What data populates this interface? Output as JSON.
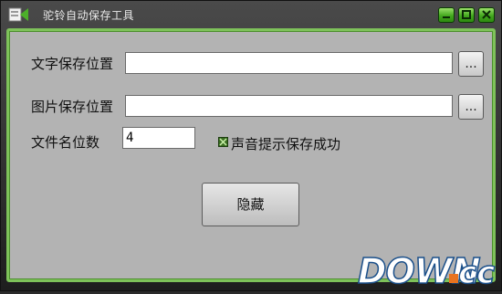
{
  "window": {
    "title": "驼铃自动保存工具"
  },
  "form": {
    "text_save_label": "文字保存位置",
    "text_save_value": "",
    "image_save_label": "图片保存位置",
    "image_save_value": "",
    "browse_label": "...",
    "filename_digits_label": "文件名位数",
    "filename_digits_value": "4",
    "sound_checkbox_label": "声音提示保存成功",
    "sound_checked": true
  },
  "actions": {
    "hide_label": "隐藏"
  },
  "watermark": {
    "text": "DOWN.cc"
  },
  "colors": {
    "accent": "#7ec25a",
    "panel": "#b3b3b3",
    "titlebar": "#2b2b2b"
  }
}
